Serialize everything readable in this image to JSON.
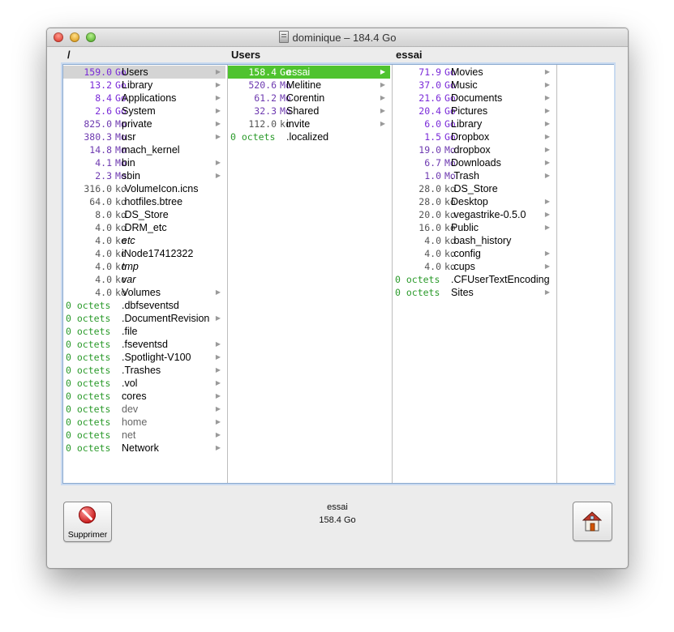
{
  "window": {
    "title": "dominique – 184.4 Go"
  },
  "columns": [
    {
      "header": "/",
      "rows": [
        {
          "size": "159.0",
          "unit": "Go",
          "name": "Users",
          "folder": true,
          "selected": "gray"
        },
        {
          "size": "13.2",
          "unit": "Go",
          "name": "Library",
          "folder": true
        },
        {
          "size": "8.4",
          "unit": "Go",
          "name": "Applications",
          "folder": true
        },
        {
          "size": "2.6",
          "unit": "Go",
          "name": "System",
          "folder": true
        },
        {
          "size": "825.0",
          "unit": "Mo",
          "name": "private",
          "folder": true
        },
        {
          "size": "380.3",
          "unit": "Mo",
          "name": "usr",
          "folder": true
        },
        {
          "size": "14.8",
          "unit": "Mo",
          "name": "mach_kernel",
          "folder": false
        },
        {
          "size": "4.1",
          "unit": "Mo",
          "name": "bin",
          "folder": true
        },
        {
          "size": "2.3",
          "unit": "Mo",
          "name": "sbin",
          "folder": true
        },
        {
          "size": "316.0",
          "unit": "ko",
          "name": ".VolumeIcon.icns",
          "folder": false
        },
        {
          "size": "64.0",
          "unit": "ko",
          "name": ".hotfiles.btree",
          "folder": false
        },
        {
          "size": "8.0",
          "unit": "ko",
          "name": ".DS_Store",
          "folder": false
        },
        {
          "size": "4.0",
          "unit": "ko",
          "name": ".DRM_etc",
          "folder": false
        },
        {
          "size": "4.0",
          "unit": "ko",
          "name": "etc",
          "folder": false,
          "italic": true
        },
        {
          "size": "4.0",
          "unit": "ko",
          "name": "iNode17412322",
          "folder": false
        },
        {
          "size": "4.0",
          "unit": "ko",
          "name": "tmp",
          "folder": false,
          "italic": true
        },
        {
          "size": "4.0",
          "unit": "ko",
          "name": "var",
          "folder": false,
          "italic": true
        },
        {
          "size": "4.0",
          "unit": "ko",
          "name": "Volumes",
          "folder": true
        },
        {
          "size": "0 octets",
          "unit": "",
          "name": ".dbfseventsd",
          "folder": false
        },
        {
          "size": "0 octets",
          "unit": "",
          "name": ".DocumentRevision",
          "folder": true
        },
        {
          "size": "0 octets",
          "unit": "",
          "name": ".file",
          "folder": false
        },
        {
          "size": "0 octets",
          "unit": "",
          "name": ".fseventsd",
          "folder": true
        },
        {
          "size": "0 octets",
          "unit": "",
          "name": ".Spotlight-V100",
          "folder": true
        },
        {
          "size": "0 octets",
          "unit": "",
          "name": ".Trashes",
          "folder": true
        },
        {
          "size": "0 octets",
          "unit": "",
          "name": ".vol",
          "folder": true
        },
        {
          "size": "0 octets",
          "unit": "",
          "name": "cores",
          "folder": true
        },
        {
          "size": "0 octets",
          "unit": "",
          "name": "dev",
          "folder": true,
          "gray": true
        },
        {
          "size": "0 octets",
          "unit": "",
          "name": "home",
          "folder": true,
          "gray": true
        },
        {
          "size": "0 octets",
          "unit": "",
          "name": "net",
          "folder": true,
          "gray": true
        },
        {
          "size": "0 octets",
          "unit": "",
          "name": "Network",
          "folder": true
        }
      ]
    },
    {
      "header": "Users",
      "rows": [
        {
          "size": "158.4",
          "unit": "Go",
          "name": "essai",
          "folder": true,
          "selected": "green"
        },
        {
          "size": "520.6",
          "unit": "Mo",
          "name": "Melitine",
          "folder": true
        },
        {
          "size": "61.2",
          "unit": "Mo",
          "name": "Corentin",
          "folder": true
        },
        {
          "size": "32.3",
          "unit": "Mo",
          "name": "Shared",
          "folder": true
        },
        {
          "size": "112.0",
          "unit": "ko",
          "name": "invite",
          "folder": true
        },
        {
          "size": "0 octets",
          "unit": "",
          "name": ".localized",
          "folder": false
        }
      ]
    },
    {
      "header": "essai",
      "rows": [
        {
          "size": "71.9",
          "unit": "Go",
          "name": "Movies",
          "folder": true
        },
        {
          "size": "37.0",
          "unit": "Go",
          "name": "Music",
          "folder": true
        },
        {
          "size": "21.6",
          "unit": "Go",
          "name": "Documents",
          "folder": true
        },
        {
          "size": "20.4",
          "unit": "Go",
          "name": "Pictures",
          "folder": true
        },
        {
          "size": "6.0",
          "unit": "Go",
          "name": "Library",
          "folder": true
        },
        {
          "size": "1.5",
          "unit": "Go",
          "name": "Dropbox",
          "folder": true
        },
        {
          "size": "19.0",
          "unit": "Mo",
          "name": ".dropbox",
          "folder": true
        },
        {
          "size": "6.7",
          "unit": "Mo",
          "name": "Downloads",
          "folder": true
        },
        {
          "size": "1.0",
          "unit": "Mo",
          "name": ".Trash",
          "folder": true
        },
        {
          "size": "28.0",
          "unit": "ko",
          "name": ".DS_Store",
          "folder": false
        },
        {
          "size": "28.0",
          "unit": "ko",
          "name": "Desktop",
          "folder": true
        },
        {
          "size": "20.0",
          "unit": "ko",
          "name": ".vegastrike-0.5.0",
          "folder": true
        },
        {
          "size": "16.0",
          "unit": "ko",
          "name": "Public",
          "folder": true
        },
        {
          "size": "4.0",
          "unit": "ko",
          "name": ".bash_history",
          "folder": false
        },
        {
          "size": "4.0",
          "unit": "ko",
          "name": ".config",
          "folder": true
        },
        {
          "size": "4.0",
          "unit": "ko",
          "name": ".cups",
          "folder": true
        },
        {
          "size": "0 octets",
          "unit": "",
          "name": ".CFUserTextEncoding",
          "folder": false
        },
        {
          "size": "0 octets",
          "unit": "",
          "name": "Sites",
          "folder": true
        }
      ]
    }
  ],
  "status": {
    "name": "essai",
    "size": "158.4 Go"
  },
  "buttons": {
    "delete_label": "Supprimer",
    "delete_icon": "no-entry-icon",
    "home_icon": "home-icon"
  },
  "colors": {
    "go": "#7a2ad8",
    "mo": "#6e3ab0",
    "ko": "#555555",
    "octets": "#2a9a2a",
    "selection": "#4fc32f"
  }
}
